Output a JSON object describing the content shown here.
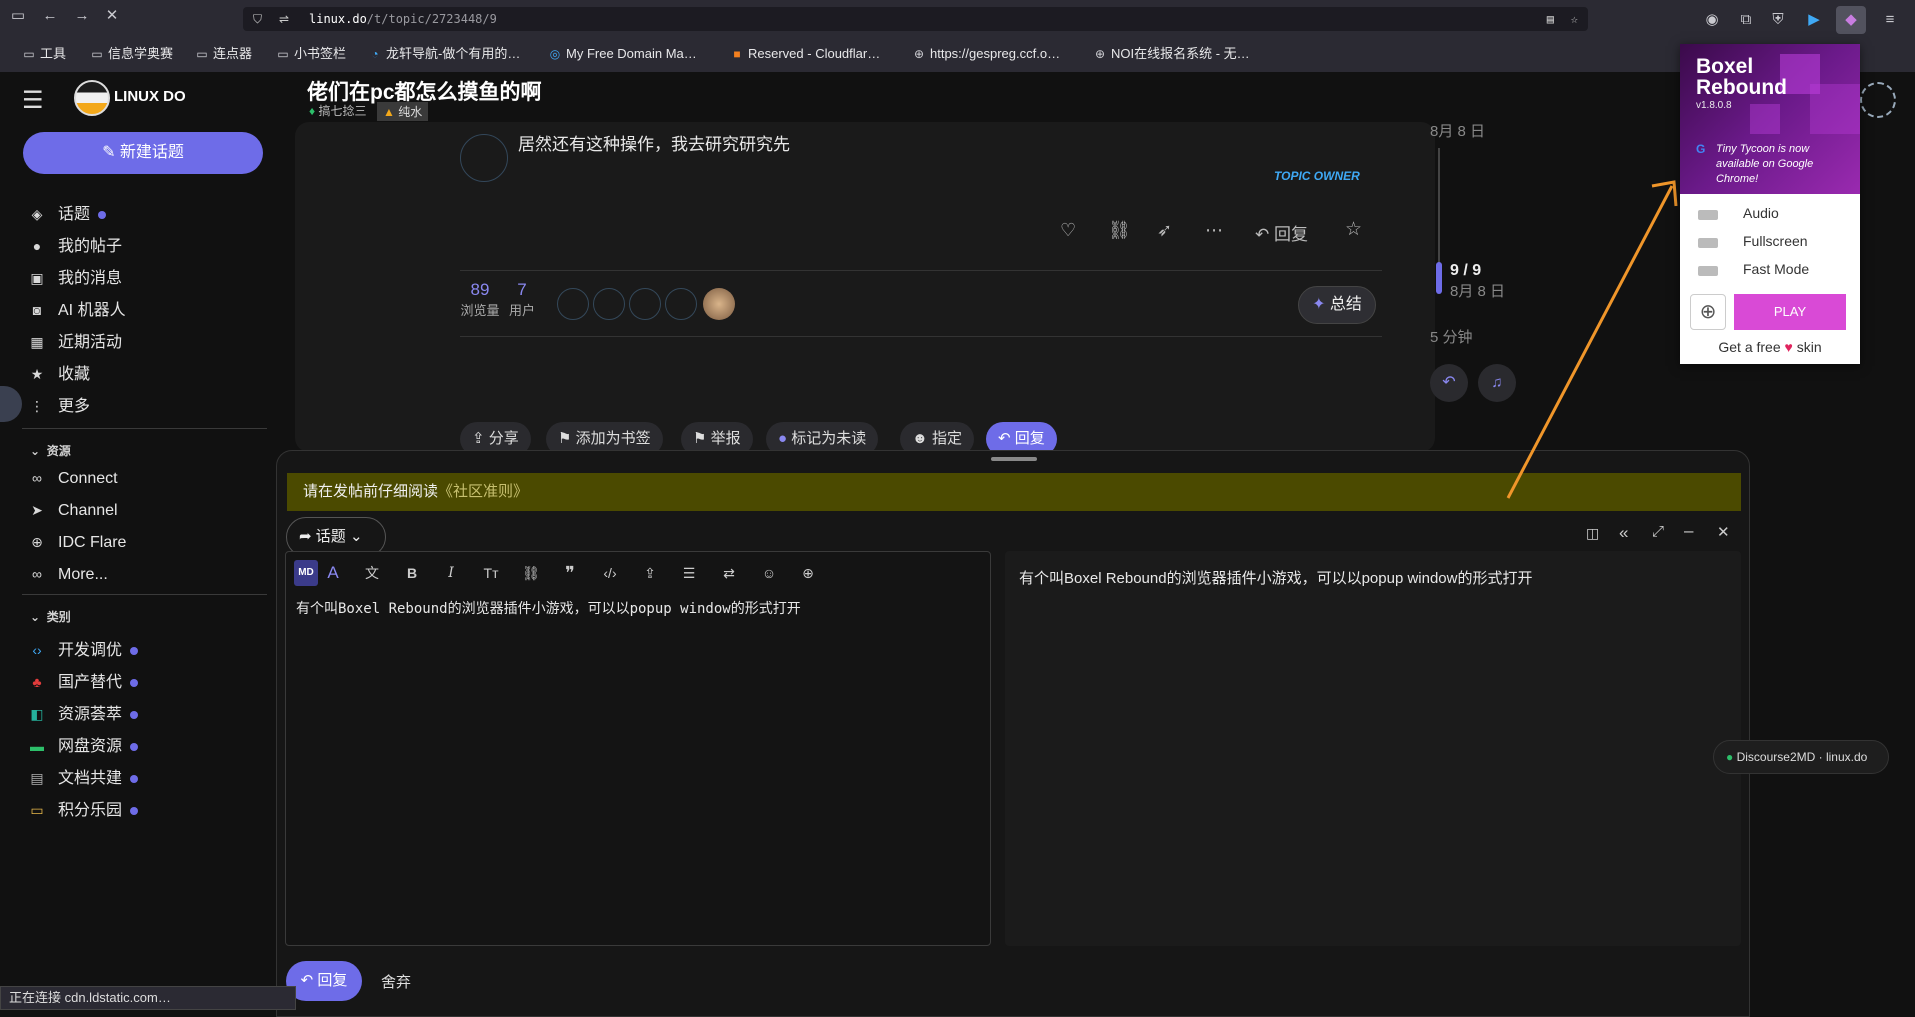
{
  "browser": {
    "url_host": "linux.do",
    "url_path": "/t/topic/2723448/9",
    "bookmarks": [
      "工具",
      "信息学奥赛",
      "连点器",
      "小书签栏",
      "龙轩导航-做个有用的…",
      "My Free Domain Ma…",
      "Reserved - Cloudflar…",
      "https://gespreg.ccf.o…",
      "NOI在线报名系统 - 无…"
    ]
  },
  "site": {
    "logo_text": "LINUX DO",
    "topic_title": "佬们在pc都怎么摸鱼的啊",
    "tag1": "搞七捻三",
    "tag2": "纯水"
  },
  "sidebar": {
    "new_topic": "新建话题",
    "items": [
      {
        "label": "话题",
        "icon": "layers-icon",
        "dot": true
      },
      {
        "label": "我的帖子",
        "icon": "user-icon"
      },
      {
        "label": "我的消息",
        "icon": "inbox-icon"
      },
      {
        "label": "AI 机器人",
        "icon": "robot-icon"
      },
      {
        "label": "近期活动",
        "icon": "calendar-icon"
      },
      {
        "label": "收藏",
        "icon": "star-icon"
      },
      {
        "label": "更多",
        "icon": "more-icon"
      }
    ],
    "resources_header": "资源",
    "resources": [
      {
        "label": "Connect",
        "icon": "link-icon"
      },
      {
        "label": "Channel",
        "icon": "telegram-icon"
      },
      {
        "label": "IDC Flare",
        "icon": "globe-icon"
      },
      {
        "label": "More...",
        "icon": "infinity-icon"
      }
    ],
    "categories_header": "类别",
    "categories": [
      {
        "label": "开发调优",
        "icon": "code-icon",
        "color": "#3fa9f5"
      },
      {
        "label": "国产替代",
        "icon": "sprout-icon",
        "color": "#e23c3c"
      },
      {
        "label": "资源荟萃",
        "icon": "share-icon",
        "color": "#25b09b"
      },
      {
        "label": "网盘资源",
        "icon": "drive-icon",
        "color": "#2dbf6a"
      },
      {
        "label": "文档共建",
        "icon": "doc-icon",
        "color": "#b0b0b0"
      },
      {
        "label": "积分乐园",
        "icon": "card-icon",
        "color": "#e6b84a"
      }
    ]
  },
  "post": {
    "text": "居然还有这种操作，我去研究研究先",
    "owner_badge": "TOPIC OWNER",
    "reply_label": "回复",
    "views_count": "89",
    "views_label": "浏览量",
    "users_count": "7",
    "users_label": "用户",
    "summary_label": "总结"
  },
  "timeline": {
    "date_top": "8月 8 日",
    "position": "9 / 9",
    "date_pos": "8月 8 日",
    "ago": "5 分钟"
  },
  "actions": [
    "分享",
    "添加为书签",
    "举报",
    "标记为未读",
    "指定",
    "回复"
  ],
  "composer": {
    "notice_prefix": "请在发帖前仔细阅读",
    "notice_link": "《社区准则》",
    "mode_label": "话题",
    "editor_text": "有个叫Boxel Rebound的浏览器插件小游戏，可以以popup window的形式打开",
    "preview_text": "有个叫Boxel Rebound的浏览器插件小游戏，可以以popup window的形式打开",
    "submit_label": "回复",
    "discard_label": "舍弃"
  },
  "popup": {
    "title1": "Boxel",
    "title2": "Rebound",
    "version": "v1.8.0.8",
    "promo": "Tiny Tycoon is now available on Google Chrome!",
    "toggles": [
      "Audio",
      "Fullscreen",
      "Fast Mode"
    ],
    "play": "PLAY",
    "footer_pre": "Get a free",
    "footer_post": "skin"
  },
  "toast": "Discourse2MD · linux.do",
  "status_bar": "正在连接 cdn.ldstatic.com…",
  "colors": {
    "accent": "#6e6ce8",
    "arrow": "#f0962a",
    "notice_bg": "#4b4a00",
    "play": "#d94ad6"
  }
}
